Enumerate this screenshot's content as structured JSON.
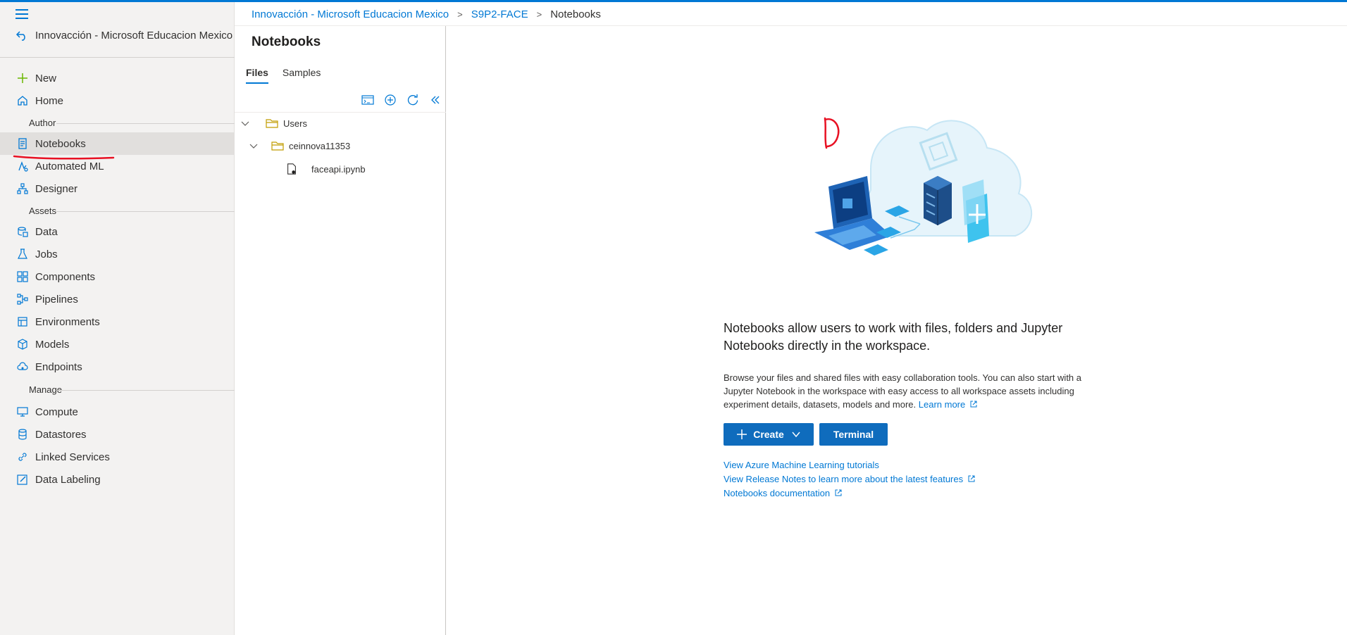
{
  "workspace": {
    "name": "Innovacción - Microsoft Educacion Mexico"
  },
  "breadcrumb": {
    "items": [
      "Innovacción - Microsoft Educacion Mexico",
      "S9P2-FACE"
    ],
    "current": "Notebooks"
  },
  "nav": {
    "top_items": [
      {
        "label": "New",
        "icon": "plus-icon"
      },
      {
        "label": "Home",
        "icon": "home-icon"
      }
    ],
    "sections": [
      {
        "title": "Author",
        "items": [
          {
            "label": "Notebooks",
            "icon": "notebook-icon",
            "active": true
          },
          {
            "label": "Automated ML",
            "icon": "automl-icon"
          },
          {
            "label": "Designer",
            "icon": "designer-icon"
          }
        ]
      },
      {
        "title": "Assets",
        "items": [
          {
            "label": "Data",
            "icon": "data-icon"
          },
          {
            "label": "Jobs",
            "icon": "flask-icon"
          },
          {
            "label": "Components",
            "icon": "components-icon"
          },
          {
            "label": "Pipelines",
            "icon": "pipelines-icon"
          },
          {
            "label": "Environments",
            "icon": "environment-icon"
          },
          {
            "label": "Models",
            "icon": "cube-icon"
          },
          {
            "label": "Endpoints",
            "icon": "cloud-icon"
          }
        ]
      },
      {
        "title": "Manage",
        "items": [
          {
            "label": "Compute",
            "icon": "monitor-icon"
          },
          {
            "label": "Datastores",
            "icon": "database-icon"
          },
          {
            "label": "Linked Services",
            "icon": "link-icon"
          },
          {
            "label": "Data Labeling",
            "icon": "edit-icon"
          }
        ]
      }
    ]
  },
  "files_panel": {
    "title": "Notebooks",
    "tabs": [
      "Files",
      "Samples"
    ],
    "active_tab": "Files",
    "toolbar": [
      "terminal-icon",
      "add-file-icon",
      "refresh-icon",
      "collapse-icon"
    ],
    "tree": [
      {
        "label": "Users",
        "type": "folder",
        "depth": 0
      },
      {
        "label": "ceinnova11353",
        "type": "folder",
        "depth": 1
      },
      {
        "label": "faceapi.ipynb",
        "type": "notebook",
        "depth": 2
      }
    ]
  },
  "main": {
    "headline": "Notebooks allow users to work with files, folders and Jupyter Notebooks directly in the workspace.",
    "description": "Browse your files and shared files with easy collaboration tools. You can also start with a Jupyter Notebook in the workspace with easy access to all workspace assets including experiment details, datasets, models and more.",
    "learn_more": "Learn more",
    "create_label": "Create",
    "terminal_label": "Terminal",
    "links": [
      "View Azure Machine Learning tutorials",
      "View Release Notes to learn more about the latest features",
      "Notebooks documentation"
    ]
  },
  "colors": {
    "accent": "#0078d4",
    "button": "#0f6cbd",
    "nav_bg": "#f3f2f1",
    "annotation": "#e81123"
  }
}
